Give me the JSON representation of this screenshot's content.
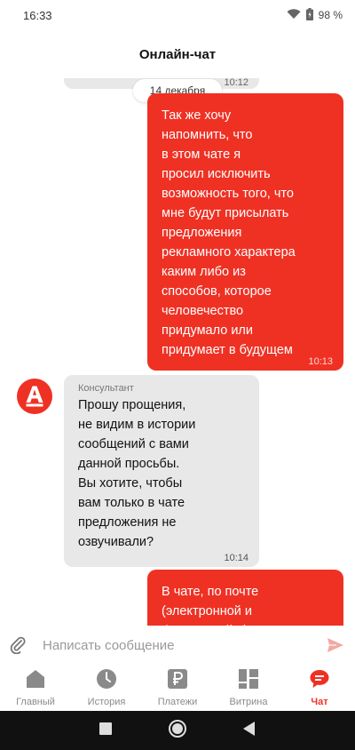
{
  "status_bar": {
    "time": "16:33",
    "battery": "98 %"
  },
  "header": {
    "title": "Онлайн-чат"
  },
  "chat": {
    "previous_message_time": "10:12",
    "date_separator": "14 декабря",
    "messages": [
      {
        "direction": "outgoing",
        "text": "Так же хочу\nнапомнить, что\nв этом чате я\nпросил исключить\nвозможность того, что\nмне будут присылать\nпредложения\nрекламного характера\nкаким либо из\nспособов, которое\nчеловечество\nпридумало или\nпридумает в будущем",
        "time": "10:13"
      },
      {
        "direction": "incoming",
        "sender": "Консультант",
        "text": "Прошу прощения,\nне видим в истории\nсообщений с вами\nданной просьбы.\nВы хотите, чтобы\nвам только в чате\nпредложения не\nозвучивали?",
        "time": "10:14"
      },
      {
        "direction": "outgoing",
        "text": "В чате, по почте\n(электронной и\nфизической...) в виде"
      }
    ]
  },
  "input": {
    "placeholder": "Написать сообщение"
  },
  "bottom_nav": {
    "items": [
      {
        "label": "Главный",
        "icon": "home-icon"
      },
      {
        "label": "История",
        "icon": "clock-icon"
      },
      {
        "label": "Платежи",
        "icon": "ruble-icon"
      },
      {
        "label": "Витрина",
        "icon": "showcase-icon"
      },
      {
        "label": "Чат",
        "icon": "chat-icon",
        "active": true
      }
    ]
  },
  "colors": {
    "accent": "#ef3124",
    "incoming_bubble": "#e8e8e8",
    "inactive_nav": "#8a8a8a"
  }
}
